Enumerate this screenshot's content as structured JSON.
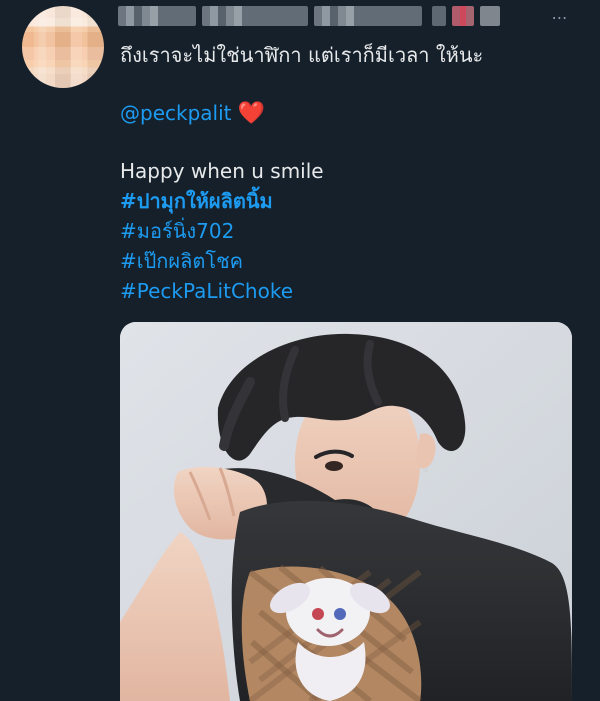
{
  "tweet": {
    "line1": "ถึงเราจะไม่ใช่นาฬิกา แต่เราก็มีเวลา ให้นะ",
    "mention": "@peckpalit",
    "heart": "❤️",
    "line3": "Happy when u smile",
    "hashtags": [
      "#ปามุกให้ผลิตนิ้ม",
      "#มอร์นิ่ง702",
      "#เป๊กผลิตโชค",
      "#PeckPaLitChoke"
    ],
    "more_icon": "⋯"
  },
  "colors": {
    "background": "#15202b",
    "text": "#e7e9ea",
    "link": "#1d9bf0",
    "heart": "#f4212e"
  },
  "icons": [
    "more-icon",
    "avatar",
    "heart-emoji"
  ]
}
